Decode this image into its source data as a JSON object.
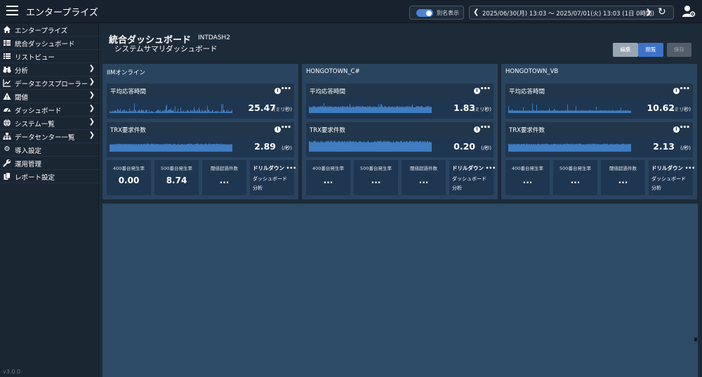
{
  "app": {
    "title": "エンタープライズ",
    "version": "v3.0.0"
  },
  "topbar": {
    "alias_label": "別名表示",
    "date_range": "2025/06/30(月) 13:03 〜 2025/07/01(火) 13:03 (1日 0時間)"
  },
  "sidebar": {
    "items": [
      {
        "label": "エンタープライズ",
        "icon": "home-icon",
        "chevron": false
      },
      {
        "label": "統合ダッシュボード",
        "icon": "table-icon",
        "chevron": false
      },
      {
        "label": "リストビュー",
        "icon": "list-icon",
        "chevron": false
      },
      {
        "label": "分析",
        "icon": "binoculars-icon",
        "chevron": true
      },
      {
        "label": "データエクスプローラー",
        "icon": "line-chart-icon",
        "chevron": true
      },
      {
        "label": "閾値",
        "icon": "warning-icon",
        "chevron": true
      },
      {
        "label": "ダッシュボード",
        "icon": "gauge-icon",
        "chevron": true
      },
      {
        "label": "システム一覧",
        "icon": "globe-icon",
        "chevron": true
      },
      {
        "label": "データセンター一覧",
        "icon": "sitemap-icon",
        "chevron": true
      },
      {
        "label": "導入設定",
        "icon": "gear-icon",
        "chevron": false
      },
      {
        "label": "運用管理",
        "icon": "wrench-icon",
        "chevron": false
      },
      {
        "label": "レポート設定",
        "icon": "copy-icon",
        "chevron": false
      }
    ]
  },
  "page": {
    "title": "統合ダッシュボード",
    "code": "INTDASH2",
    "subtitle": "システムサマリダッシュボード",
    "buttons": {
      "edit": "編集",
      "view": "閲覧",
      "save": "保存"
    }
  },
  "panels": [
    {
      "title": "IIMオンライン",
      "metrics": [
        {
          "name": "平均応答時間",
          "value": "25.47",
          "unit": "(ミリ秒)"
        },
        {
          "name": "TRX要求件数",
          "value": "2.89",
          "unit": "(/秒)"
        }
      ],
      "stats": [
        {
          "label": "400番台発生率",
          "value": "0.00"
        },
        {
          "label": "500番台発生率",
          "value": "8.74"
        },
        {
          "label": "閾値超過件数",
          "value": "..."
        }
      ],
      "drill": {
        "title": "ドリルダウン",
        "links": [
          "ダッシュボード",
          "分析"
        ]
      }
    },
    {
      "title": "HONGOTOWN_C#",
      "metrics": [
        {
          "name": "平均応答時間",
          "value": "1.83",
          "unit": "(ミリ秒)"
        },
        {
          "name": "TRX要求件数",
          "value": "0.20",
          "unit": "(/秒)"
        }
      ],
      "stats": [
        {
          "label": "400番台発生率",
          "value": "..."
        },
        {
          "label": "500番台発生率",
          "value": "..."
        },
        {
          "label": "閾値超過件数",
          "value": "..."
        }
      ],
      "drill": {
        "title": "ドリルダウン",
        "links": [
          "ダッシュボード",
          "分析"
        ]
      }
    },
    {
      "title": "HONGOTOWN_VB",
      "metrics": [
        {
          "name": "平均応答時間",
          "value": "10.62",
          "unit": "(ミリ秒)"
        },
        {
          "name": "TRX要求件数",
          "value": "2.13",
          "unit": "(/秒)"
        }
      ],
      "stats": [
        {
          "label": "400番台発生率",
          "value": "..."
        },
        {
          "label": "500番台発生率",
          "value": "..."
        },
        {
          "label": "閾値超過件数",
          "value": "..."
        }
      ],
      "drill": {
        "title": "ドリルダウン",
        "links": [
          "ダッシュボード",
          "分析"
        ]
      }
    }
  ],
  "colors": {
    "accent": "#3c73c8",
    "panel": "#29445f",
    "tile": "#1f3650",
    "spark": "#3f7cc0"
  }
}
